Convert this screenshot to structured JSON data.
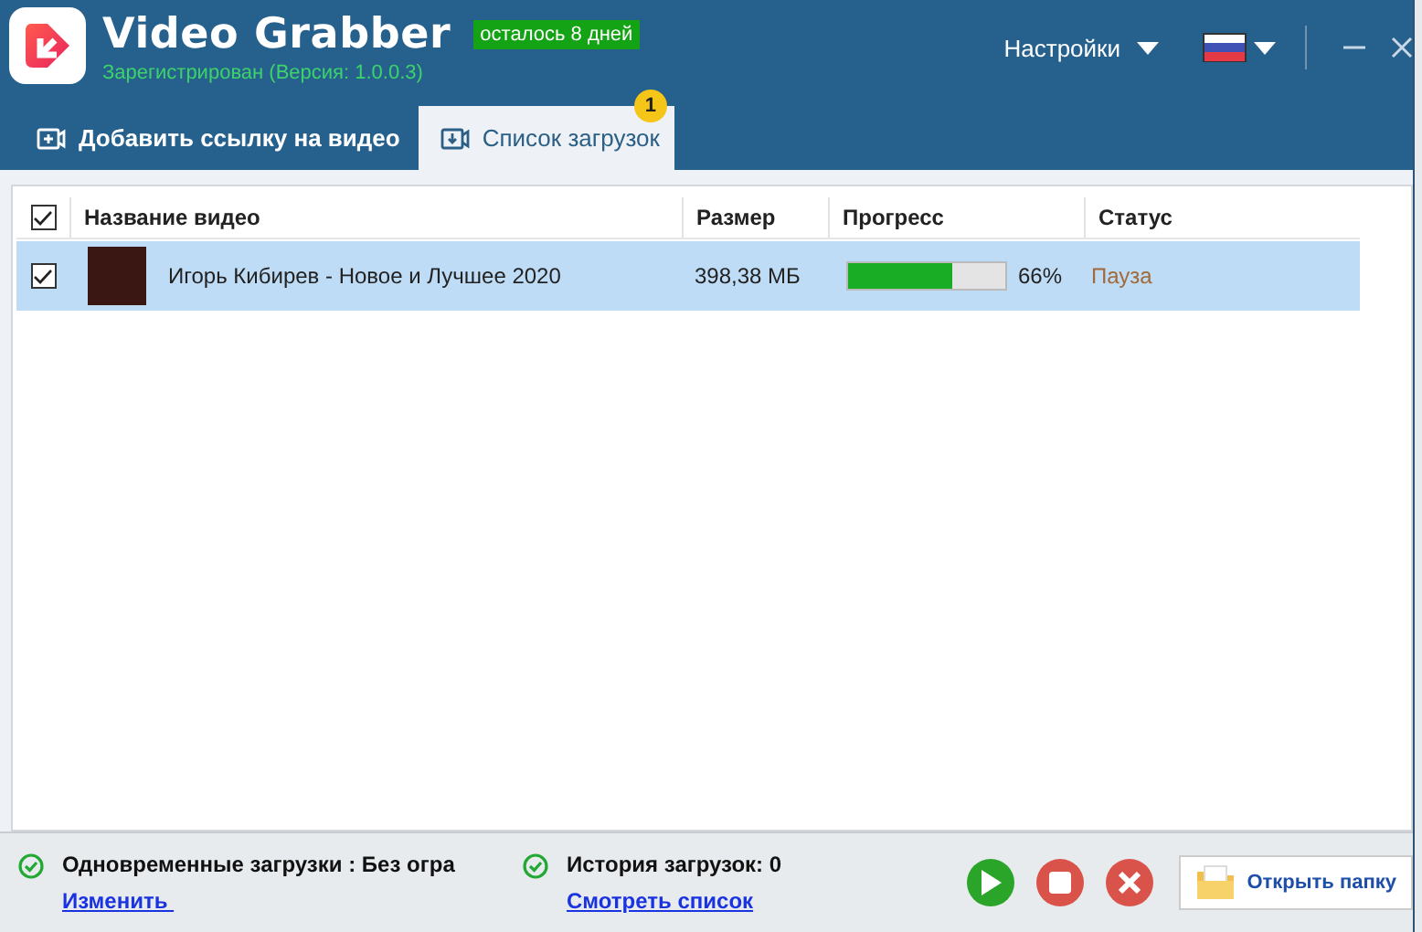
{
  "app": {
    "title": "Video Grabber",
    "trial_badge": "осталось 8 дней",
    "registration": "Зарегистрирован (Версия: 1.0.0.3)",
    "settings_menu": "Настройки"
  },
  "tabs": [
    {
      "label": "Добавить ссылку на видео",
      "selected": false
    },
    {
      "label": "Список загрузок",
      "selected": true,
      "badge": "1"
    }
  ],
  "table": {
    "select_all_checked": true,
    "columns": [
      "Название видео",
      "Размер",
      "Прогресс",
      "Статус"
    ],
    "rows": [
      {
        "checked": true,
        "selected": true,
        "name": "Игорь Кибирев  -  Новое и Лучшее 2020",
        "size": "398,38 МБ",
        "level": 0.66,
        "reading": "66%",
        "status": "Пауза"
      }
    ]
  },
  "footer": {
    "items": [
      {
        "text": "Одновременные загрузки : Без огра",
        "link": "Изменить "
      },
      {
        "text": "История загрузок: 0",
        "link": "Смотреть список"
      }
    ],
    "open_folder": "Открыть папку"
  }
}
